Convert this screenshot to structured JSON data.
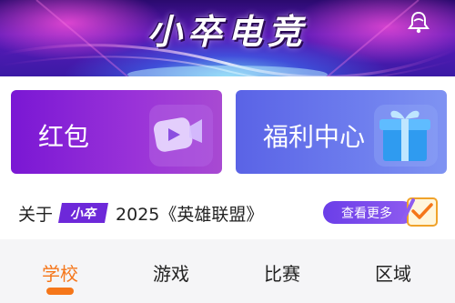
{
  "banner": {
    "title": "小卒电竞",
    "bell_icon": "bell-icon"
  },
  "tiles": [
    {
      "label": "红包",
      "icon": "video-play-icon",
      "color": "#8a24d6"
    },
    {
      "label": "福利中心",
      "icon": "gift-box-icon",
      "color": "#6672ea"
    }
  ],
  "info": {
    "prefix": "关于",
    "brand": "小卒",
    "text": "2025《英雄联盟》",
    "more_label": "查看更多",
    "more_icon": "check-note-icon"
  },
  "tabs": [
    {
      "label": "学校",
      "active": true
    },
    {
      "label": "游戏",
      "active": false
    },
    {
      "label": "比赛",
      "active": false
    },
    {
      "label": "区域",
      "active": false
    }
  ],
  "colors": {
    "accent": "#f5761a",
    "tab_bg": "#f5f5f7",
    "more_button": "#7a4aec"
  }
}
